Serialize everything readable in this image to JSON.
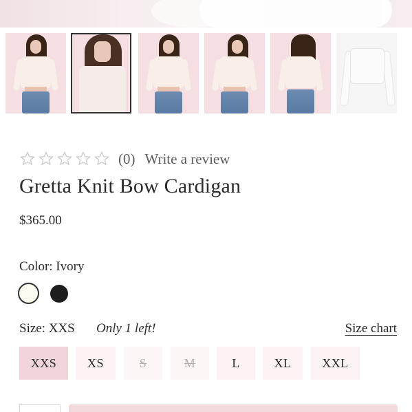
{
  "product": {
    "title": "Gretta Knit Bow Cardigan",
    "price": "$365.00"
  },
  "reviews": {
    "rating": 0,
    "max_rating": 5,
    "count_label": "(0)",
    "write_review_label": "Write a review"
  },
  "color": {
    "label": "Color: Ivory",
    "options": [
      {
        "name": "ivory",
        "hex": "#fcfbf0",
        "selected": true
      },
      {
        "name": "black",
        "hex": "#1d1d1d",
        "selected": false
      }
    ]
  },
  "size": {
    "label": "Size: XXS",
    "stock_note": "Only 1 left!",
    "size_chart_label": "Size chart",
    "options": [
      {
        "label": "XXS",
        "state": "selected"
      },
      {
        "label": "XS",
        "state": "available"
      },
      {
        "label": "S",
        "state": "unavailable"
      },
      {
        "label": "M",
        "state": "unavailable"
      },
      {
        "label": "L",
        "state": "available"
      },
      {
        "label": "XL",
        "state": "available"
      },
      {
        "label": "XXL",
        "state": "available"
      }
    ]
  },
  "gallery": {
    "selected_thumbnail": 2,
    "thumbnail_count": 6
  },
  "colors": {
    "accent_pink": "#f0d6da",
    "thumb_background": "#f6dfe2",
    "text": "#2b2b2b"
  }
}
